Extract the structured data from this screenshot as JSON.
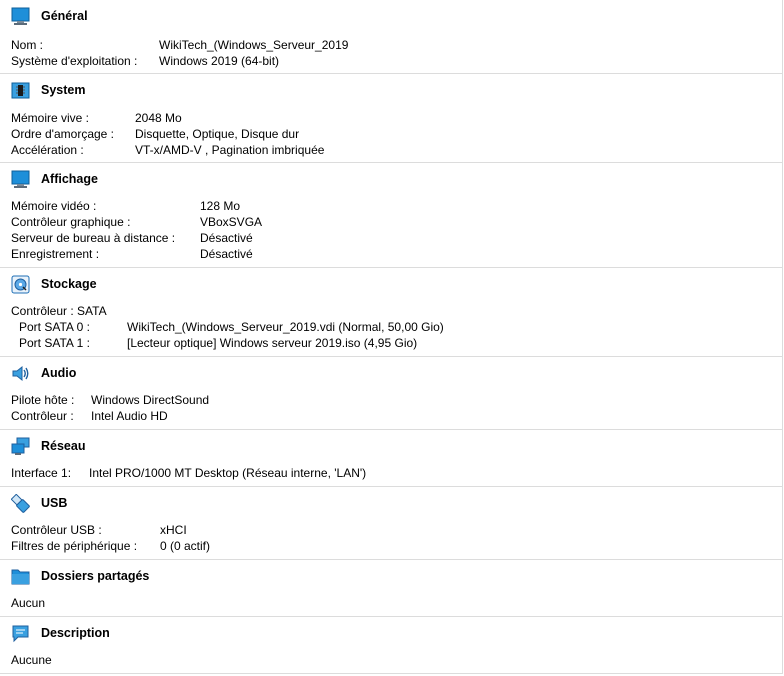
{
  "sections": {
    "general": {
      "title": "Général",
      "icon": "monitor-icon",
      "rows": [
        {
          "label": "Nom :",
          "value": "WikiTech_(Windows_Serveur_2019"
        },
        {
          "label": "Système d'exploitation :",
          "value": "Windows 2019 (64-bit)"
        }
      ]
    },
    "system": {
      "title": "System",
      "icon": "chip-icon",
      "rows": [
        {
          "label": "Mémoire vive :",
          "value": "2048 Mo"
        },
        {
          "label": "Ordre d'amorçage :",
          "value": "Disquette, Optique, Disque dur"
        },
        {
          "label": "Accélération :",
          "value": "VT-x/AMD-V , Pagination imbriquée"
        }
      ]
    },
    "display": {
      "title": "Affichage",
      "icon": "display-icon",
      "rows": [
        {
          "label": "Mémoire vidéo :",
          "value": "128 Mo"
        },
        {
          "label": "Contrôleur graphique :",
          "value": "VBoxSVGA"
        },
        {
          "label": "Serveur de bureau à distance :",
          "value": "Désactivé"
        },
        {
          "label": "Enregistrement :",
          "value": "Désactivé"
        }
      ]
    },
    "storage": {
      "title": "Stockage",
      "icon": "storage-icon",
      "controller": "Contrôleur : SATA",
      "rows": [
        {
          "label": "Port SATA 0 :",
          "value": "WikiTech_(Windows_Serveur_2019.vdi (Normal, 50,00 Gio)"
        },
        {
          "label": "Port SATA 1 :",
          "value": "[Lecteur optique] Windows serveur 2019.iso (4,95 Gio)"
        }
      ]
    },
    "audio": {
      "title": "Audio",
      "icon": "speaker-icon",
      "rows": [
        {
          "label": "Pilote hôte :",
          "value": "Windows DirectSound"
        },
        {
          "label": "Contrôleur :",
          "value": "Intel Audio HD"
        }
      ]
    },
    "network": {
      "title": "Réseau",
      "icon": "network-icon",
      "rows": [
        {
          "label": "Interface 1:",
          "value": "Intel PRO/1000 MT Desktop (Réseau interne, 'LAN')"
        }
      ]
    },
    "usb": {
      "title": "USB",
      "icon": "usb-icon",
      "rows": [
        {
          "label": "Contrôleur USB :",
          "value": "xHCI"
        },
        {
          "label": "Filtres de périphérique :",
          "value": "0 (0 actif)"
        }
      ]
    },
    "shared": {
      "title": "Dossiers partagés",
      "icon": "folder-icon",
      "text": "Aucun"
    },
    "description": {
      "title": "Description",
      "icon": "speech-bubble-icon",
      "text": "Aucune"
    }
  },
  "colors": {
    "icon_blue": "#1e8fd9",
    "icon_dark": "#1f5f9e",
    "divider": "#dcdcdc"
  }
}
